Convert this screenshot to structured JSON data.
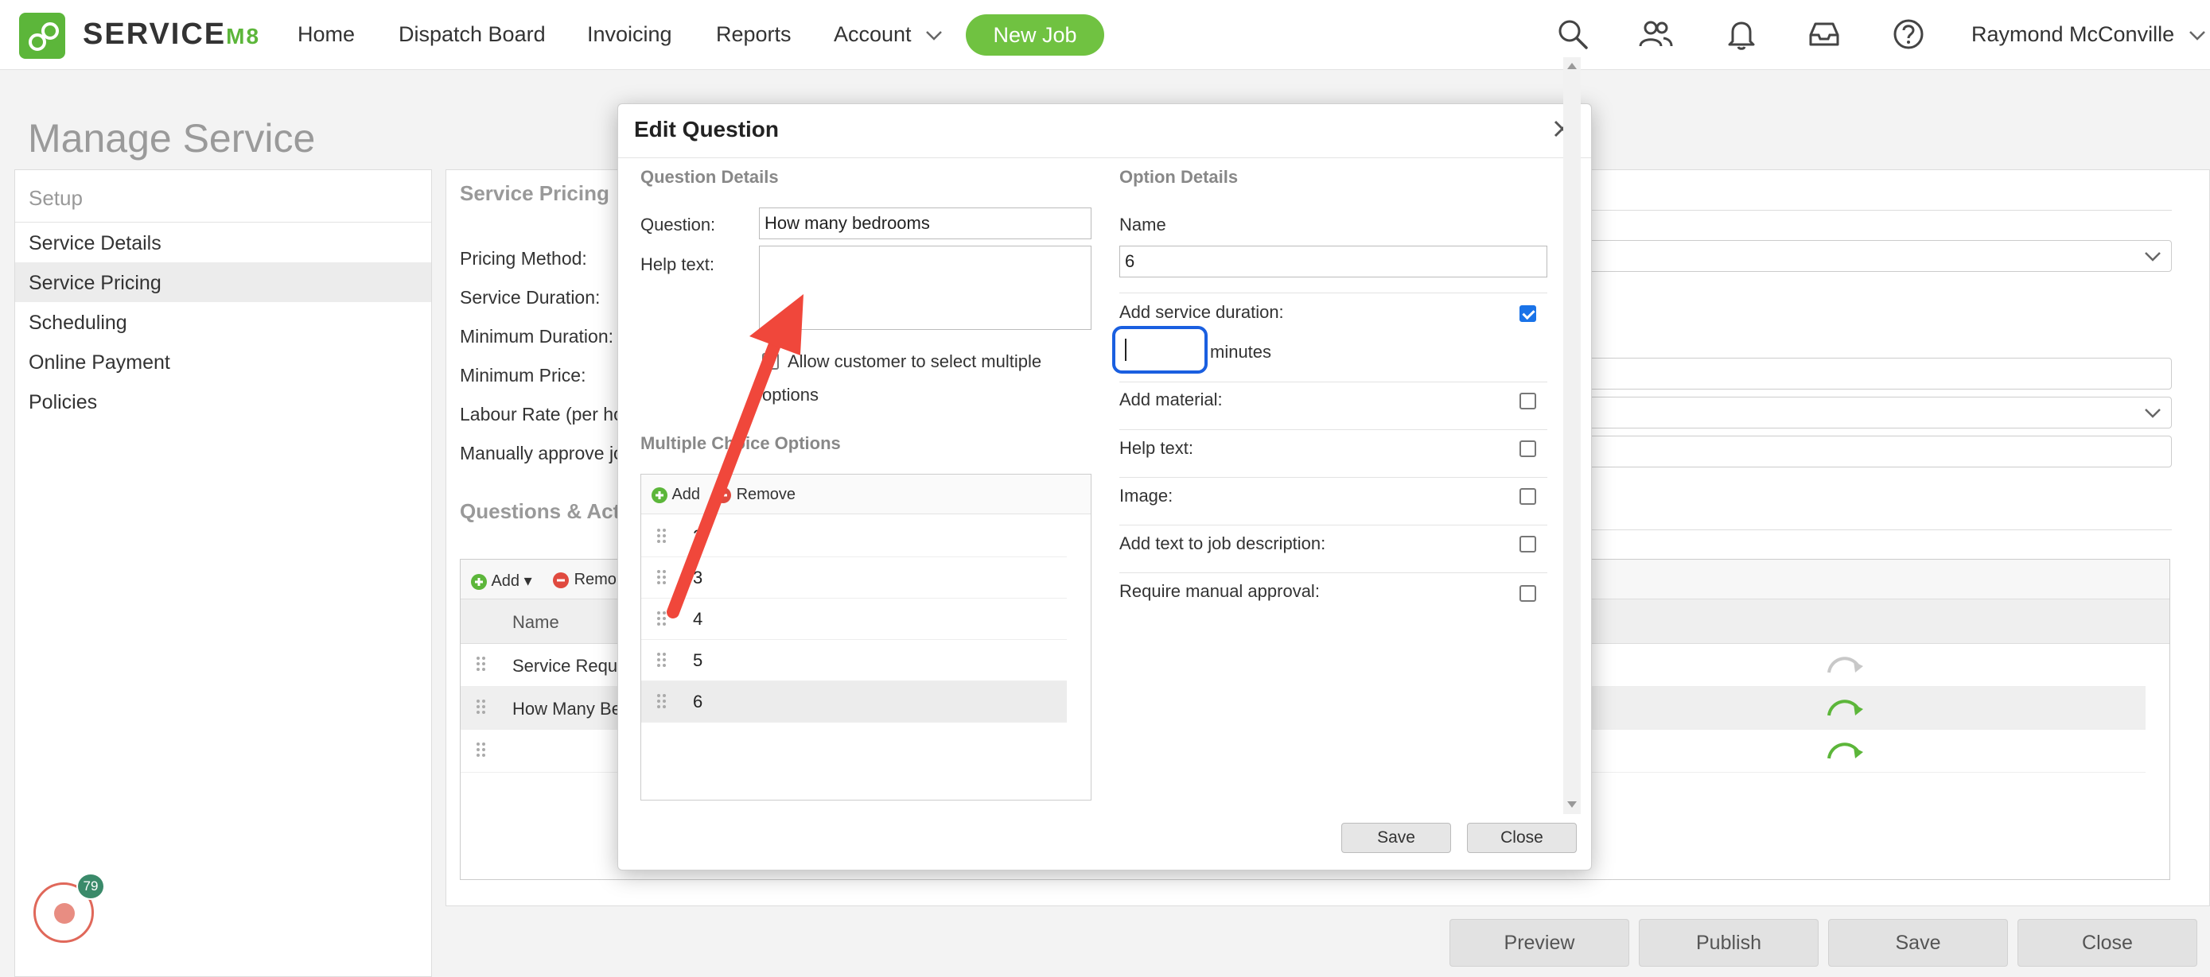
{
  "nav": {
    "logo_text": "SERVICE",
    "logo_suffix": "M8",
    "items": [
      "Home",
      "Dispatch Board",
      "Invoicing",
      "Reports",
      "Account"
    ],
    "new_job": "New Job",
    "user": "Raymond McConville"
  },
  "page": {
    "title": "Manage Service"
  },
  "setup": {
    "heading": "Setup",
    "items": [
      "Service Details",
      "Service Pricing",
      "Scheduling",
      "Online Payment",
      "Policies"
    ]
  },
  "pricing": {
    "title": "Service Pricing",
    "labels": [
      "Pricing Method:",
      "Service Duration:",
      "Minimum Duration:",
      "Minimum Price:",
      "Labour Rate (per hou",
      "Manually approve jo"
    ]
  },
  "qa": {
    "title": "Questions & Acti",
    "add": "Add",
    "remove": "Remo",
    "col_name": "Name",
    "rows": [
      "Service Requi",
      "How Many Be",
      ""
    ]
  },
  "badge": {
    "count": "79"
  },
  "bottom": {
    "preview": "Preview",
    "publish": "Publish",
    "save": "Save",
    "close": "Close"
  },
  "modal": {
    "title": "Edit Question",
    "question_details": "Question Details",
    "question_label": "Question:",
    "question_value": "How many bedrooms",
    "help_label": "Help text:",
    "allow_multi_line1": "Allow customer to select multiple",
    "allow_multi_line2": "options",
    "mc_title": "Multiple Choice Options",
    "mc_add": "Add",
    "mc_remove": "Remove",
    "mc_options": [
      "2",
      "3",
      "4",
      "5",
      "6"
    ],
    "option_details": "Option Details",
    "name_label": "Name",
    "name_value": "6",
    "add_duration": "Add service duration:",
    "minutes": "minutes",
    "add_material": "Add material:",
    "help_text": "Help text:",
    "image": "Image:",
    "add_text_job": "Add text to job description:",
    "require_manual": "Require manual approval:",
    "save": "Save",
    "close": "Close"
  },
  "colors": {
    "brand": "#5cb63a",
    "new_job": "#70c241",
    "arrow": "#f0473b",
    "focus": "#1a5fe0"
  }
}
